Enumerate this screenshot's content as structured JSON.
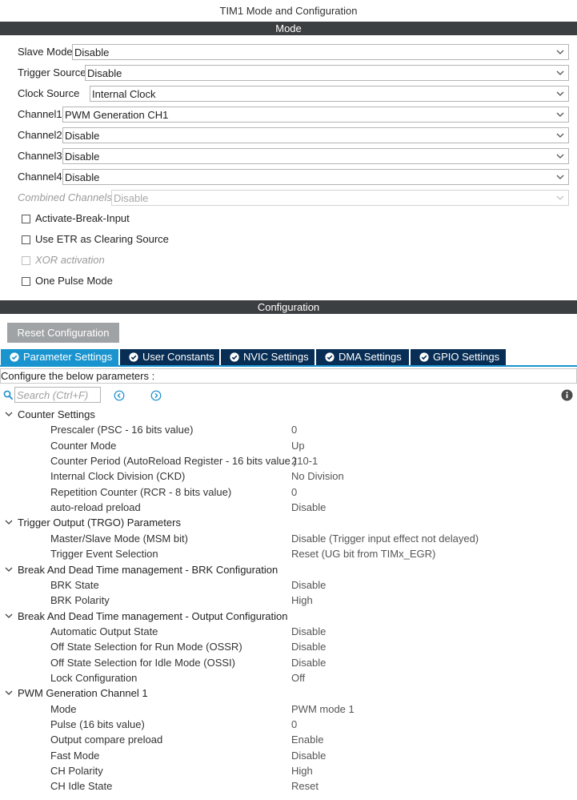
{
  "window": {
    "title": "TIM1 Mode and Configuration"
  },
  "mode": {
    "header": "Mode",
    "fields": [
      {
        "label": "Slave Mode",
        "value": "Disable",
        "disabled": false
      },
      {
        "label": "Trigger Source",
        "value": "Disable",
        "disabled": false
      },
      {
        "label": "Clock Source",
        "value": "Internal Clock",
        "disabled": false
      },
      {
        "label": "Channel1",
        "value": "PWM Generation CH1",
        "disabled": false
      },
      {
        "label": "Channel2",
        "value": "Disable",
        "disabled": false
      },
      {
        "label": "Channel3",
        "value": "Disable",
        "disabled": false
      },
      {
        "label": "Channel4",
        "value": "Disable",
        "disabled": false
      },
      {
        "label": "Combined Channels",
        "value": "Disable",
        "disabled": true
      }
    ],
    "checkboxes": [
      {
        "label": "Activate-Break-Input",
        "checked": false,
        "disabled": false
      },
      {
        "label": "Use ETR as Clearing Source",
        "checked": false,
        "disabled": false
      },
      {
        "label": "XOR activation",
        "checked": false,
        "disabled": true
      },
      {
        "label": "One Pulse Mode",
        "checked": false,
        "disabled": false
      }
    ]
  },
  "configuration": {
    "header": "Configuration",
    "reset_label": "Reset Configuration",
    "tabs": [
      {
        "label": "Parameter Settings",
        "active": true
      },
      {
        "label": "User Constants",
        "active": false
      },
      {
        "label": "NVIC Settings",
        "active": false
      },
      {
        "label": "DMA Settings",
        "active": false
      },
      {
        "label": "GPIO Settings",
        "active": false
      }
    ],
    "instructions": "Configure the below parameters :",
    "search_placeholder": "Search (Ctrl+F)",
    "groups": [
      {
        "title": "Counter Settings",
        "params": [
          {
            "name": "Prescaler (PSC - 16 bits value)",
            "value": "0"
          },
          {
            "name": "Counter Mode",
            "value": "Up"
          },
          {
            "name": "Counter Period (AutoReload Register - 16 bits value )",
            "value": "210-1"
          },
          {
            "name": "Internal Clock Division (CKD)",
            "value": "No Division"
          },
          {
            "name": "Repetition Counter (RCR - 8 bits value)",
            "value": "0"
          },
          {
            "name": "auto-reload preload",
            "value": "Disable"
          }
        ]
      },
      {
        "title": "Trigger Output (TRGO) Parameters",
        "params": [
          {
            "name": "Master/Slave Mode (MSM bit)",
            "value": "Disable (Trigger input effect not delayed)"
          },
          {
            "name": "Trigger Event Selection",
            "value": "Reset (UG bit from TIMx_EGR)"
          }
        ]
      },
      {
        "title": "Break And Dead Time management - BRK Configuration",
        "params": [
          {
            "name": "BRK State",
            "value": "Disable"
          },
          {
            "name": "BRK Polarity",
            "value": "High"
          }
        ]
      },
      {
        "title": "Break And Dead Time management - Output Configuration",
        "params": [
          {
            "name": "Automatic Output State",
            "value": "Disable"
          },
          {
            "name": "Off State Selection for Run Mode (OSSR)",
            "value": "Disable"
          },
          {
            "name": "Off State Selection for Idle Mode (OSSI)",
            "value": "Disable"
          },
          {
            "name": "Lock Configuration",
            "value": "Off"
          }
        ]
      },
      {
        "title": "PWM Generation Channel 1",
        "params": [
          {
            "name": "Mode",
            "value": "PWM mode 1"
          },
          {
            "name": "Pulse (16 bits value)",
            "value": "0"
          },
          {
            "name": "Output compare preload",
            "value": "Enable"
          },
          {
            "name": "Fast Mode",
            "value": "Disable"
          },
          {
            "name": "CH Polarity",
            "value": "High"
          },
          {
            "name": "CH Idle State",
            "value": "Reset"
          }
        ]
      }
    ]
  },
  "icons": {
    "dropdown": "chevron-down-icon",
    "tab": "check-circle-icon",
    "search": "search-icon",
    "prev": "prev-arrow-icon",
    "next": "next-arrow-icon",
    "info": "info-icon",
    "group_toggle": "chevron-down-icon"
  },
  "colors": {
    "band": "#3c3f42",
    "tab_active": "#1a94cf",
    "tab_inactive": "#082e55",
    "reset_button": "#a0a3a6"
  }
}
